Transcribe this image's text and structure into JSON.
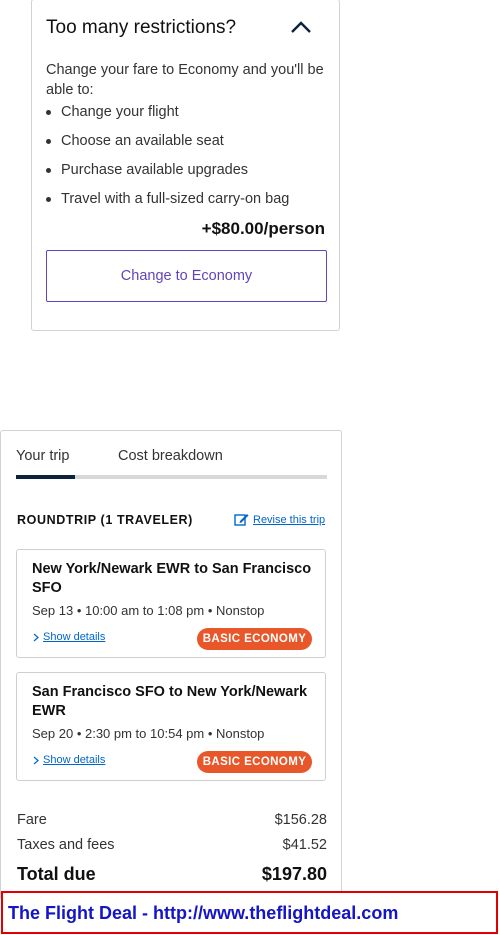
{
  "upsell": {
    "title": "Too many restrictions?",
    "body": "Change your fare to Economy and you'll be able to:",
    "benefits": [
      "Change your flight",
      "Choose an available seat",
      "Purchase available upgrades",
      "Travel with a full-sized carry-on bag"
    ],
    "price": "+$80.00/person",
    "button_label": "Change to Economy",
    "toggle_icon": "chevron-up-icon"
  },
  "trip": {
    "tabs": [
      "Your trip",
      "Cost breakdown"
    ],
    "heading": "ROUNDTRIP (1 TRAVELER)",
    "revise_label": "Revise this trip",
    "flights": [
      {
        "route": "New York/Newark EWR to San Francisco SFO",
        "times": "Sep 13 • 10:00 am to 1:08 pm • Nonstop",
        "details_label": "Show details",
        "badge": "BASIC ECONOMY"
      },
      {
        "route": "San Francisco SFO to New York/Newark EWR",
        "times": "Sep 20 • 2:30 pm to 10:54 pm • Nonstop",
        "details_label": "Show details",
        "badge": "BASIC ECONOMY"
      }
    ],
    "costs": {
      "fare_label": "Fare",
      "fare_value": "$156.28",
      "taxes_label": "Taxes and fees",
      "taxes_value": "$41.52",
      "total_label": "Total due",
      "total_value": "$197.80"
    }
  },
  "banner": {
    "text": "The Flight Deal - http://www.theflightdeal.com"
  },
  "colors": {
    "accent": "#6244bb",
    "badge": "#e8572a",
    "link": "#0066cc",
    "tab_active": "#0c2340",
    "banner_border": "#e00000",
    "banner_text": "#1414c8"
  }
}
